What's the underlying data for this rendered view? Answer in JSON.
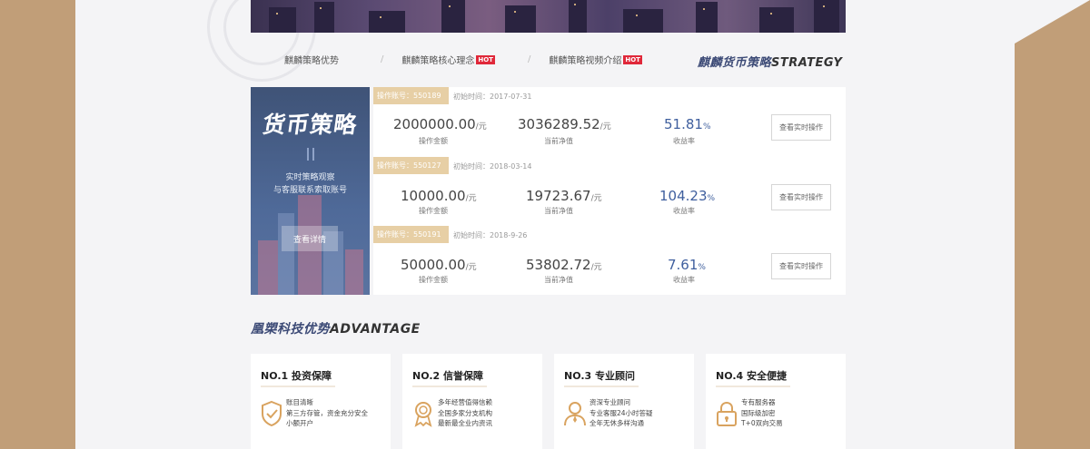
{
  "nav": {
    "items": [
      {
        "label": "麒麟策略优势",
        "hot": ""
      },
      {
        "label": "麒麟策略核心理念",
        "hot": "HOT"
      },
      {
        "label": "麒麟策略视频介绍",
        "hot": "HOT"
      }
    ],
    "separator": "/"
  },
  "strategy_section": {
    "title_cn": "麒麟货币策略",
    "title_en": "STRATEGY"
  },
  "strategy_card": {
    "title": "货币策略",
    "line1": "实时策略观察",
    "line2": "与客服联系索取账号",
    "button": "查看详情"
  },
  "accounts": [
    {
      "account": "操作账号：550189",
      "start": "初始时间：2017-07-31",
      "amount": "2000000.00",
      "amount_unit": "/元",
      "amount_label": "操作金额",
      "nav": "3036289.52",
      "nav_unit": "/元",
      "nav_label": "当前净值",
      "rate": "51.81",
      "rate_unit": "%",
      "rate_label": "收益率",
      "button": "查看实时操作"
    },
    {
      "account": "操作账号：550127",
      "start": "初始时间：2018-03-14",
      "amount": "10000.00",
      "amount_unit": "/元",
      "amount_label": "操作金额",
      "nav": "19723.67",
      "nav_unit": "/元",
      "nav_label": "当前净值",
      "rate": "104.23",
      "rate_unit": "%",
      "rate_label": "收益率",
      "button": "查看实时操作"
    },
    {
      "account": "操作账号：550191",
      "start": "初始时间：2018-9-26",
      "amount": "50000.00",
      "amount_unit": "/元",
      "amount_label": "操作金额",
      "nav": "53802.72",
      "nav_unit": "/元",
      "nav_label": "当前净值",
      "rate": "7.61",
      "rate_unit": "%",
      "rate_label": "收益率",
      "button": "查看实时操作"
    }
  ],
  "advantage_section": {
    "title_cn": "凰槊科技优势",
    "title_en": "ADVANTAGE"
  },
  "advantages": [
    {
      "title": "NO.1 投资保障",
      "icon": "shield-check-icon",
      "lines": [
        "账目清晰",
        "第三方存管，资金充分安全",
        "小额开户"
      ]
    },
    {
      "title": "NO.2 信誉保障",
      "icon": "award-medal-icon",
      "lines": [
        "多年经营值得信赖",
        "全国多家分支机构",
        "最新最全业内资讯"
      ]
    },
    {
      "title": "NO.3 专业顾问",
      "icon": "advisor-person-icon",
      "lines": [
        "资深专业顾问",
        "专业客服24小时答疑",
        "全年无休多样沟通"
      ]
    },
    {
      "title": "NO.4 安全便捷",
      "icon": "padlock-icon",
      "lines": [
        "专有服务器",
        "国际级加密",
        "T+0双向交易"
      ]
    }
  ],
  "colors": {
    "outer_bg": "#c19e78",
    "page_bg": "#f4f4f6",
    "accent_blue": "#3f5f9e",
    "tag_gold": "#e7cfa5",
    "hot_red": "#e0283a",
    "icon_gold": "#d9a35f"
  }
}
